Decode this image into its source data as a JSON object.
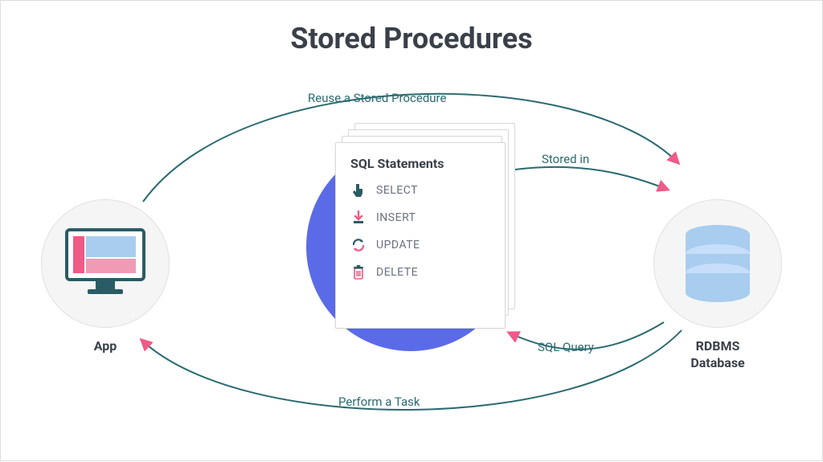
{
  "title": "Stored Procedures",
  "app": {
    "label": "App"
  },
  "db": {
    "label": "RDBMS\nDatabase"
  },
  "center": {
    "card_title": "SQL Statements",
    "statements": [
      "SELECT",
      "INSERT",
      "UPDATE",
      "DELETE"
    ]
  },
  "edges": {
    "reuse": "Reuse a Stored Procedure",
    "stored": "Stored in",
    "query": "SQL Query",
    "task": "Perform a Task"
  },
  "colors": {
    "teal": "#2a6a71",
    "pink": "#ef5a87",
    "blue": "#5b6be8",
    "lightblue": "#a8cdee",
    "gray_bg": "#f5f5f5"
  }
}
